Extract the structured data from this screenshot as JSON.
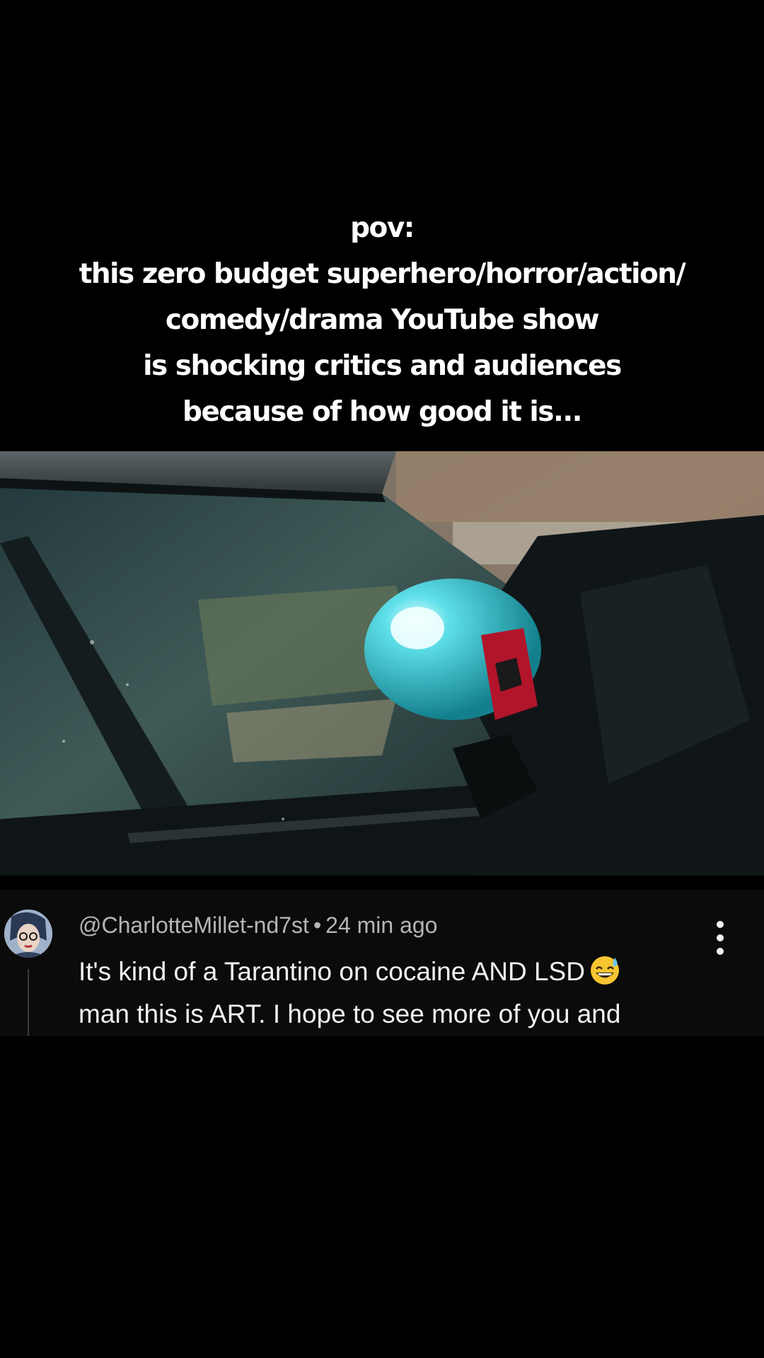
{
  "caption": {
    "lines": [
      "pov:",
      "this zero budget superhero/horror/action/",
      "comedy/drama YouTube show",
      "is shocking critics and audiences",
      "because of how good it is..."
    ]
  },
  "video": {
    "description_icon": "video-still"
  },
  "comment": {
    "author": "@CharlotteMillet-nd7st",
    "separator": "•",
    "time_ago": "24 min ago",
    "text_lines": [
      "It's kind of a Tarantino on cocaine AND LSD",
      "man this is ART. I hope to see more of you and"
    ],
    "emoji_icon": "grinning-sweat-emoji",
    "more_icon": "more-vertical-icon"
  },
  "colors": {
    "background": "#000000",
    "caption_text": "#ffffff",
    "comment_bg": "#0b0b0b",
    "meta_text": "#b5b5b5",
    "comment_text": "#f1f1f1",
    "helmet_teal": "#1fb3c2"
  }
}
